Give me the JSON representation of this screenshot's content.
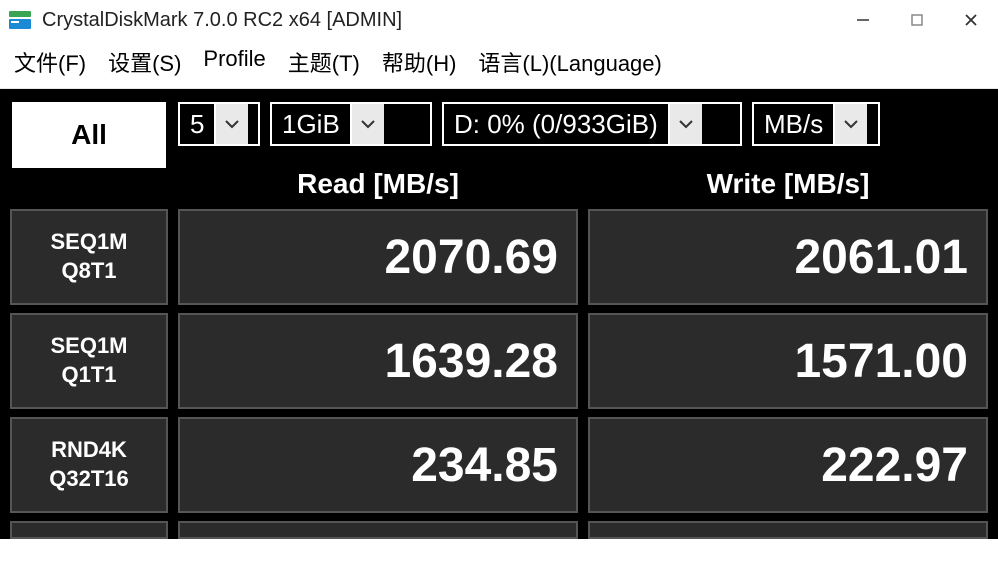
{
  "titlebar": {
    "title": "CrystalDiskMark 7.0.0 RC2 x64 [ADMIN]"
  },
  "menubar": {
    "file": "文件(F)",
    "settings": "设置(S)",
    "profile": "Profile",
    "theme": "主题(T)",
    "help": "帮助(H)",
    "language": "语言(L)(Language)"
  },
  "controls": {
    "all_label": "All",
    "test_count": "5",
    "test_size": "1GiB",
    "drive": "D: 0% (0/933GiB)",
    "unit": "MB/s"
  },
  "columns": {
    "read_header": "Read [MB/s]",
    "write_header": "Write [MB/s]"
  },
  "tests": [
    {
      "name_line1": "SEQ1M",
      "name_line2": "Q8T1",
      "read": "2070.69",
      "write": "2061.01"
    },
    {
      "name_line1": "SEQ1M",
      "name_line2": "Q1T1",
      "read": "1639.28",
      "write": "1571.00"
    },
    {
      "name_line1": "RND4K",
      "name_line2": "Q32T16",
      "read": "234.85",
      "write": "222.97"
    }
  ]
}
